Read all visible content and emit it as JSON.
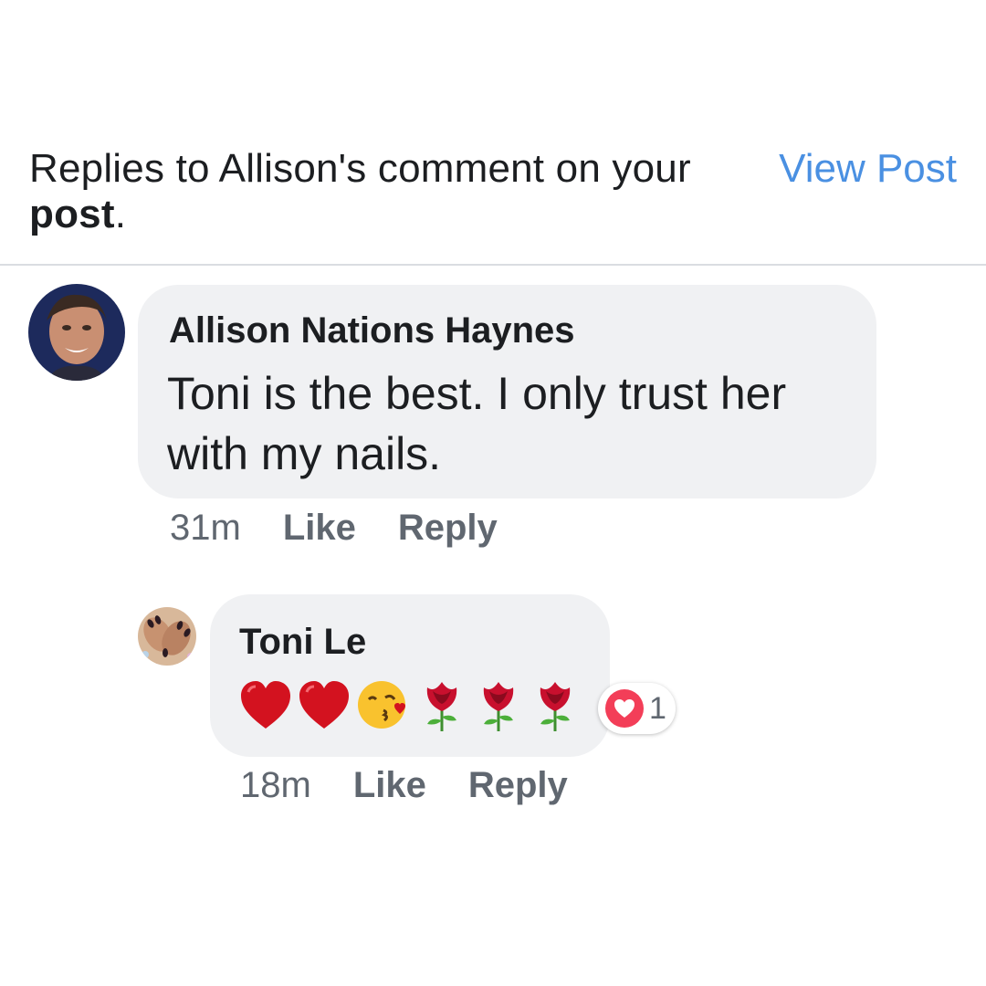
{
  "header": {
    "title_prefix": "Replies to Allison's comment on your ",
    "title_bold": "post",
    "title_suffix": ".",
    "view_post_label": "View Post"
  },
  "comment": {
    "author": "Allison Nations Haynes",
    "text": "Toni is the best. I only trust her with my nails.",
    "time": "31m",
    "like_label": "Like",
    "reply_label": "Reply"
  },
  "reply": {
    "author": "Toni Le",
    "emojis": [
      "heart-emoji",
      "heart-emoji",
      "kissing-face-emoji",
      "rose-emoji",
      "rose-emoji",
      "rose-emoji"
    ],
    "reaction_icon": "heart-reaction-icon",
    "reaction_count": "1",
    "time": "18m",
    "like_label": "Like",
    "reply_label": "Reply"
  },
  "colors": {
    "link_blue": "#4a90e2",
    "bubble_bg": "#f0f1f3",
    "meta_gray": "#606770",
    "reaction_red": "#f33e58"
  }
}
